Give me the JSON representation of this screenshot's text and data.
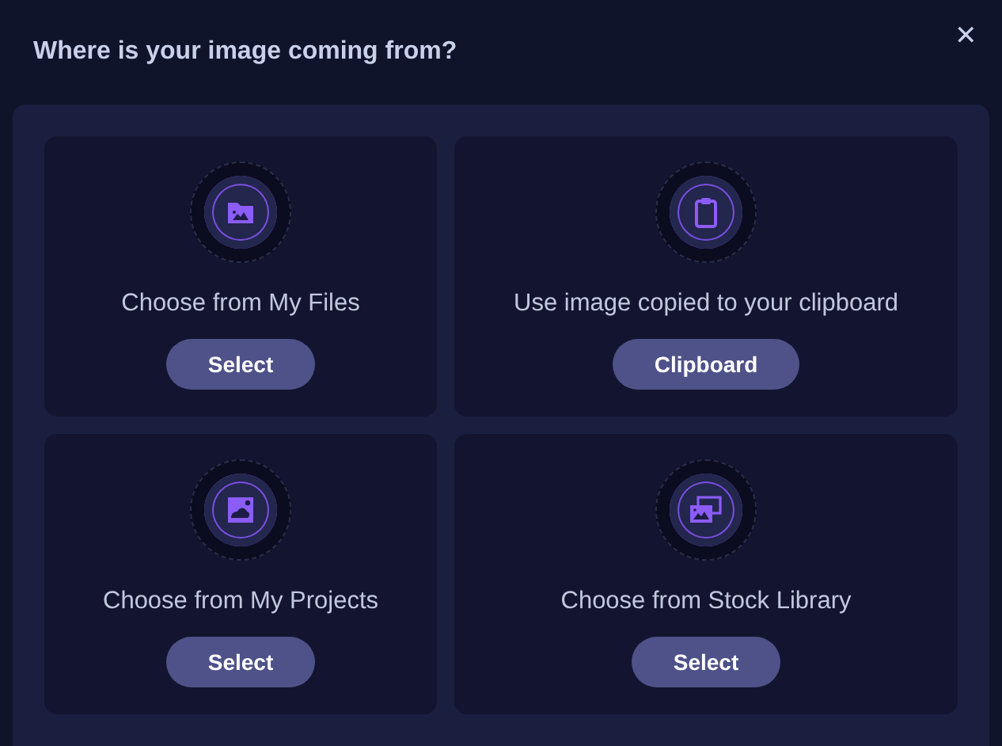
{
  "dialog": {
    "title": "Where is your image coming from?",
    "close": "✕"
  },
  "options": [
    {
      "kind": "files",
      "label": "Choose from My Files",
      "button": "Select"
    },
    {
      "kind": "clipboard",
      "label": "Use image copied to your clipboard",
      "button": "Clipboard"
    },
    {
      "kind": "projects",
      "label": "Choose from My Projects",
      "button": "Select"
    },
    {
      "kind": "stock",
      "label": "Choose from Stock Library",
      "button": "Select"
    }
  ]
}
